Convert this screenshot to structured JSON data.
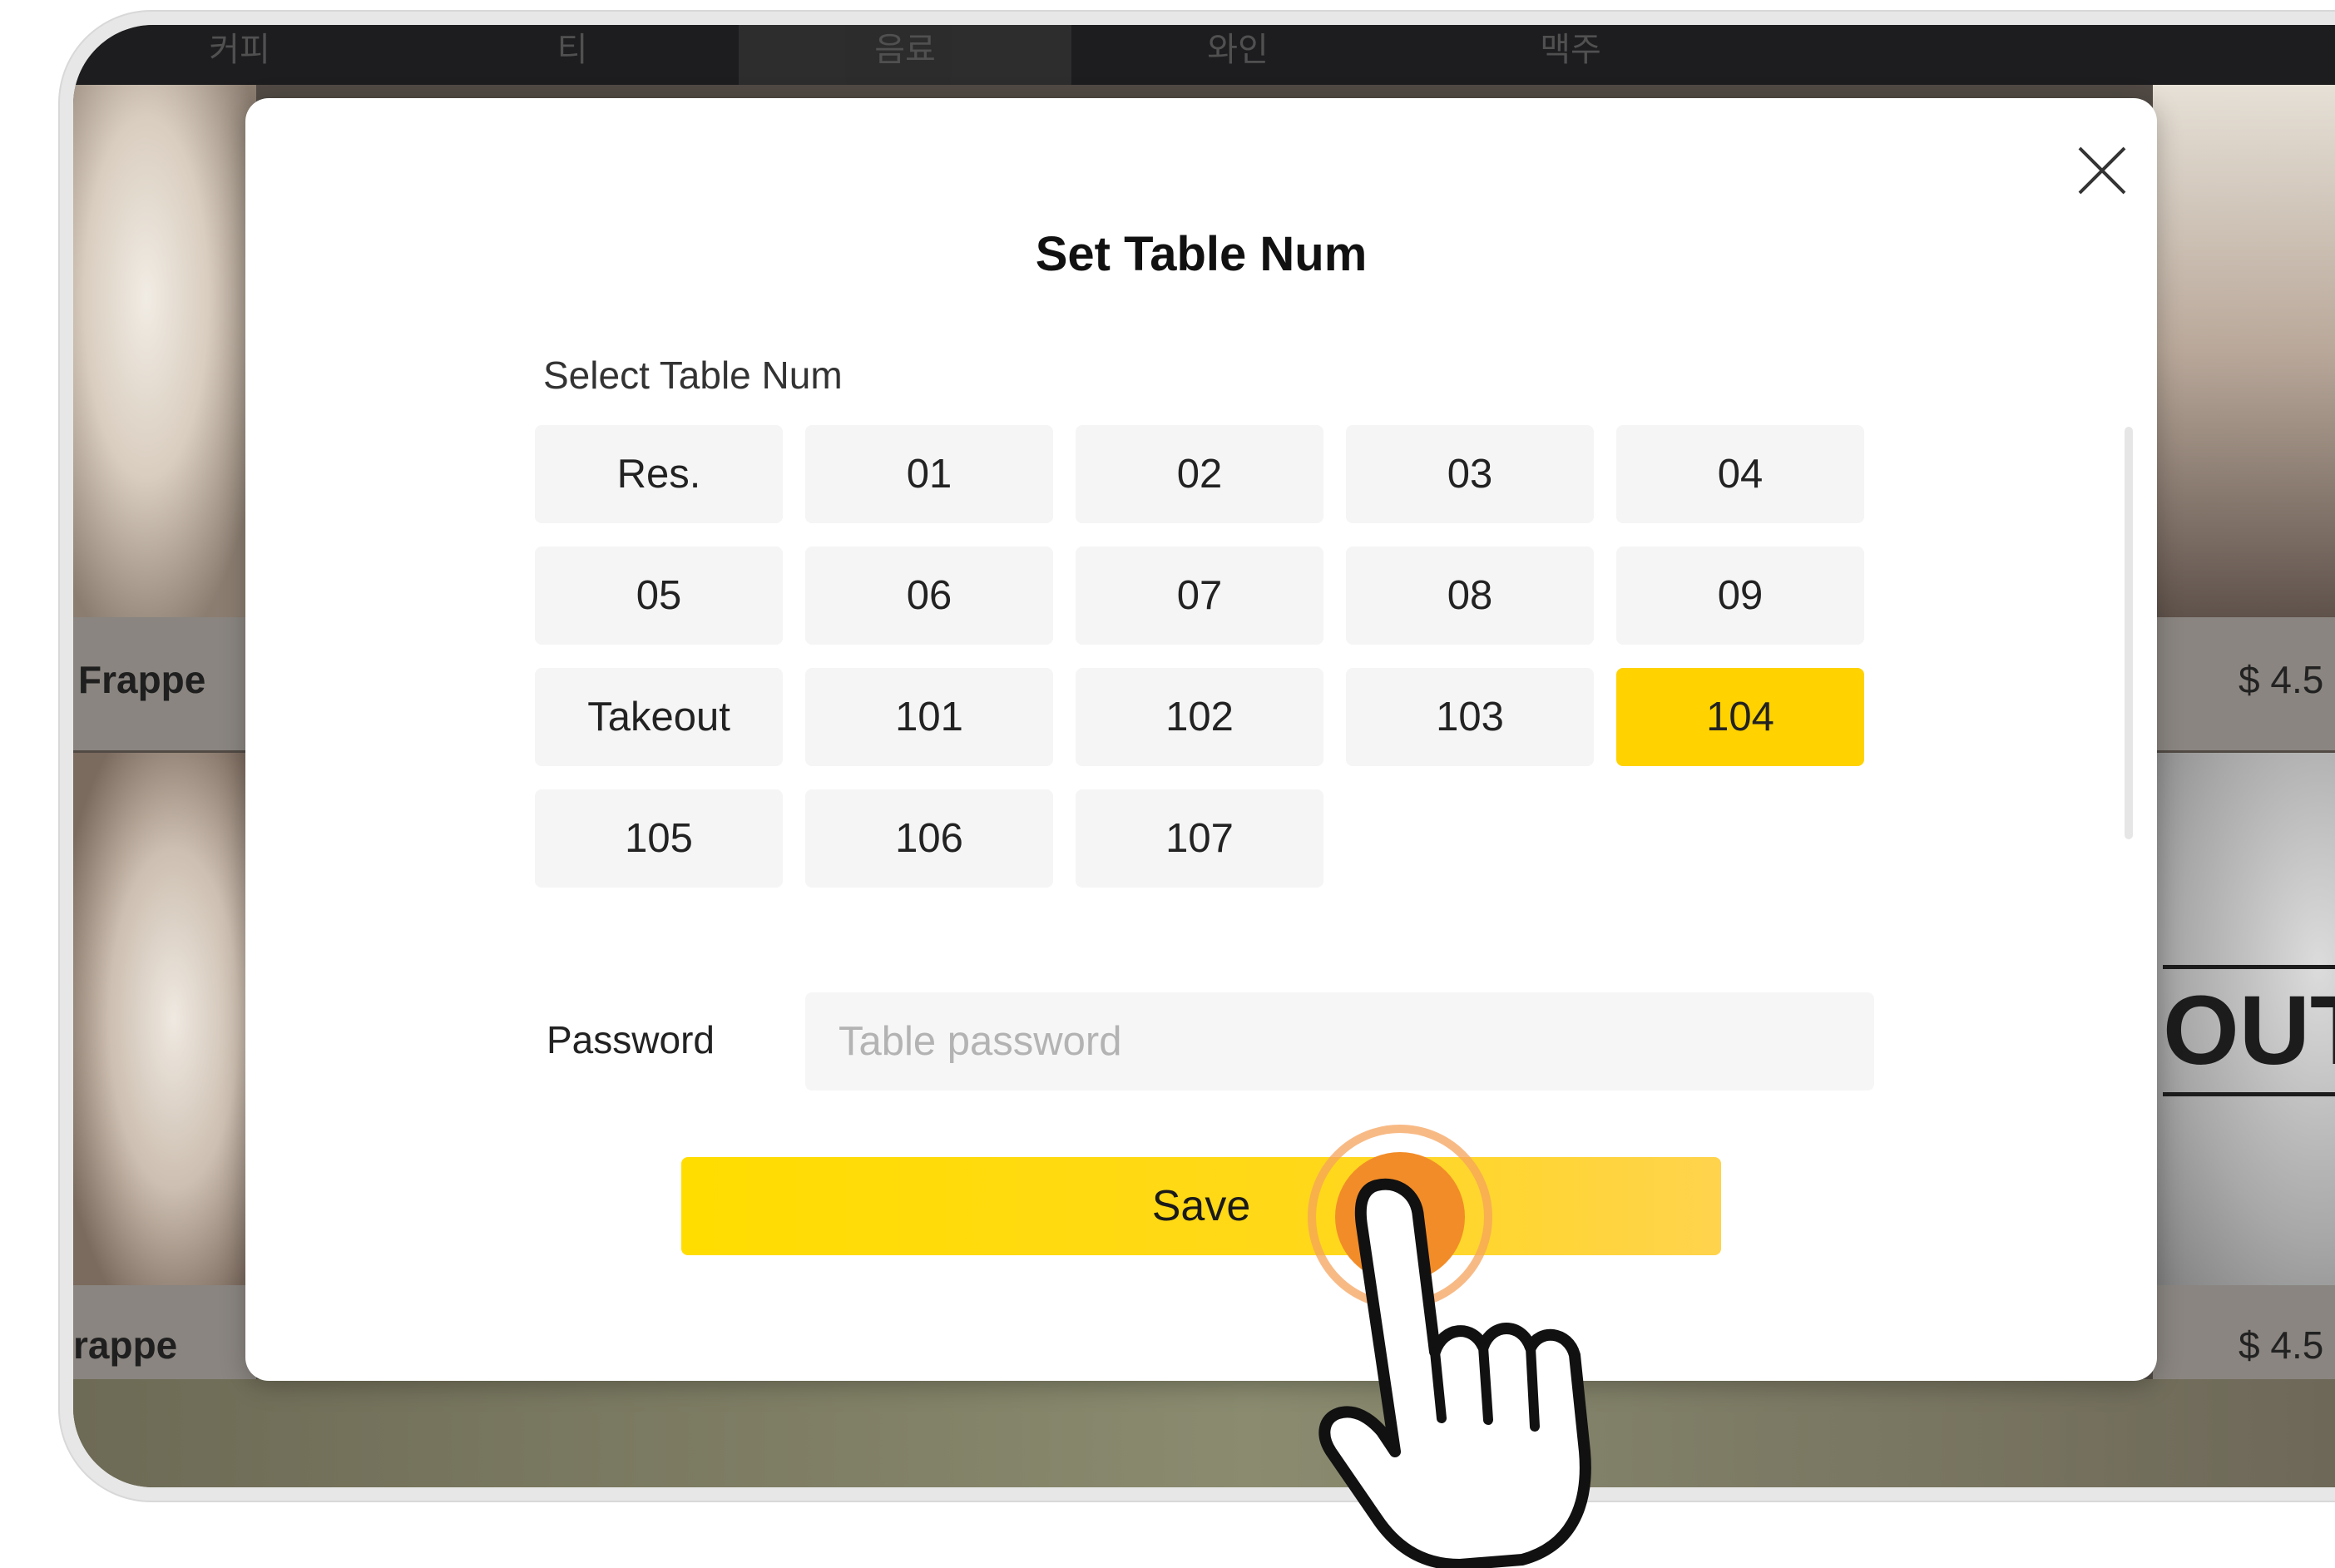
{
  "background": {
    "top_tabs": [
      "커피",
      "티",
      "음료",
      "와인",
      "맥주"
    ],
    "left_cards": [
      {
        "label": "Frappe"
      },
      {
        "label": "rappe"
      }
    ],
    "right_cards": [
      {
        "price": "$ 4.5"
      },
      {
        "price": "$ 4.5"
      }
    ],
    "stamp_text": "OUT"
  },
  "modal": {
    "title": "Set Table Num",
    "section_label": "Select Table Num",
    "tables": [
      "Res.",
      "01",
      "02",
      "03",
      "04",
      "05",
      "06",
      "07",
      "08",
      "09",
      "Takeout",
      "101",
      "102",
      "103",
      "104",
      "105",
      "106",
      "107"
    ],
    "selected_table": "104",
    "password_label": "Password",
    "password_placeholder": "Table password",
    "save_label": "Save",
    "close_icon": "close-icon"
  },
  "overlay": {
    "hand_icon": "pointing-hand-icon",
    "tap_color": "#f28c28"
  }
}
